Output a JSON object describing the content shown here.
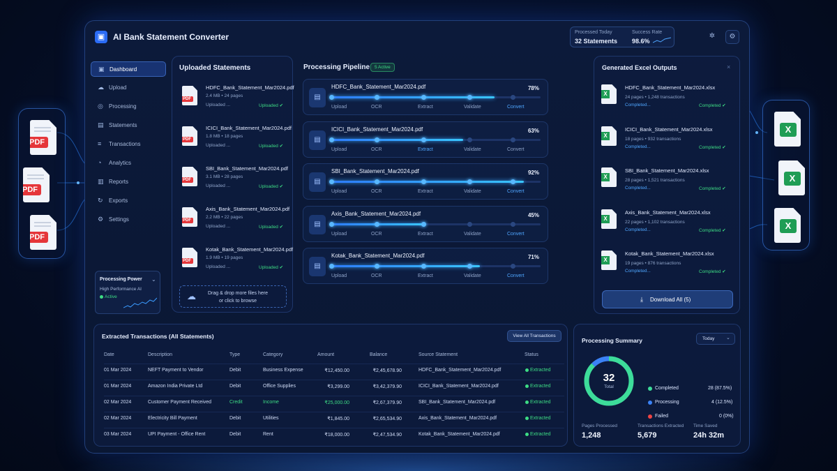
{
  "app": {
    "title": "AI Bank Statement Converter"
  },
  "header_stats": {
    "processed_label": "Processed Today",
    "processed_value": "32 Statements",
    "success_label": "Success Rate",
    "success_value": "98.6%"
  },
  "side_left": {
    "tag": "PDF"
  },
  "side_right": {
    "tag": "X"
  },
  "sidebar": {
    "items": [
      {
        "label": "Dashboard",
        "icon": "dashboard-icon"
      },
      {
        "label": "Upload",
        "icon": "upload-icon"
      },
      {
        "label": "Processing",
        "icon": "processing-icon"
      },
      {
        "label": "Statements",
        "icon": "statements-icon"
      },
      {
        "label": "Transactions",
        "icon": "transactions-icon"
      },
      {
        "label": "Analytics",
        "icon": "analytics-icon"
      },
      {
        "label": "Reports",
        "icon": "reports-icon"
      },
      {
        "label": "Exports",
        "icon": "exports-icon"
      },
      {
        "label": "Settings",
        "icon": "settings-icon"
      }
    ],
    "power": {
      "title": "Processing Power",
      "subtitle": "High Performance AI",
      "status": "Active"
    }
  },
  "uploaded": {
    "title": "Uploaded Statements",
    "files": [
      {
        "name": "HDFC_Bank_Statement_Mar2024.pdf",
        "meta": "2.4 MB • 24 pages",
        "state": "Uploaded ...",
        "status": "Uploaded ✔"
      },
      {
        "name": "ICICI_Bank_Statement_Mar2024.pdf",
        "meta": "1.8 MB • 18 pages",
        "state": "Uploaded ...",
        "status": "Uploaded ✔"
      },
      {
        "name": "SBI_Bank_Statement_Mar2024.pdf",
        "meta": "3.1 MB • 28 pages",
        "state": "Uploaded ...",
        "status": "Uploaded ✔"
      },
      {
        "name": "Axis_Bank_Statement_Mar2024.pdf",
        "meta": "2.2 MB • 22 pages",
        "state": "Uploaded ...",
        "status": "Uploaded ✔"
      },
      {
        "name": "Kotak_Bank_Statement_Mar2024.pdf",
        "meta": "1.9 MB • 19 pages",
        "state": "Uploaded ...",
        "status": "Uploaded ✔"
      }
    ],
    "pdf_tag": "PDF",
    "drop_line1": "Drag & drop more files here",
    "drop_line2": "or click to browse"
  },
  "pipeline": {
    "title": "Processing Pipeline",
    "badge": "5 Active",
    "stages": [
      "Upload",
      "OCR",
      "Extract",
      "Validate",
      "Convert"
    ],
    "rows": [
      {
        "name": "HDFC_Bank_Statement_Mar2024.pdf",
        "percent_label": "78%",
        "progress": 0.78,
        "active_stage": 4
      },
      {
        "name": "ICICI_Bank_Statement_Mar2024.pdf",
        "percent_label": "63%",
        "progress": 0.63,
        "active_stage": 2
      },
      {
        "name": "SBI_Bank_Statement_Mar2024.pdf",
        "percent_label": "92%",
        "progress": 0.92,
        "active_stage": 4
      },
      {
        "name": "Axis_Bank_Statement_Mar2024.pdf",
        "percent_label": "45%",
        "progress": 0.45,
        "active_stage": 4
      },
      {
        "name": "Kotak_Bank_Statement_Mar2024.pdf",
        "percent_label": "71%",
        "progress": 0.71,
        "active_stage": 4
      }
    ]
  },
  "outputs": {
    "title": "Generated Excel Outputs",
    "xl_tag": "X",
    "files": [
      {
        "name": "HDFC_Bank_Statement_Mar2024.xlsx",
        "meta": "24 pages • 1,248 transactions",
        "state": "Completed...",
        "status": "Completed ✔"
      },
      {
        "name": "ICICI_Bank_Statement_Mar2024.xlsx",
        "meta": "18 pages • 932 transactions",
        "state": "Completed...",
        "status": "Completed ✔"
      },
      {
        "name": "SBI_Bank_Statement_Mar2024.xlsx",
        "meta": "28 pages • 1,521 transactions",
        "state": "Completed...",
        "status": "Completed ✔"
      },
      {
        "name": "Axis_Bank_Statement_Mar2024.xlsx",
        "meta": "22 pages • 1,102 transactions",
        "state": "Completed...",
        "status": "Completed ✔"
      },
      {
        "name": "Kotak_Bank_Statement_Mar2024.xlsx",
        "meta": "19 pages • 876 transactions",
        "state": "Completed...",
        "status": "Completed ✔"
      }
    ],
    "download_label": "Download All (5)"
  },
  "transactions": {
    "title": "Extracted Transactions (All Statements)",
    "view_all": "View All Transactions",
    "columns": [
      "Date",
      "Description",
      "Type",
      "Category",
      "Amount",
      "Balance",
      "Source Statement",
      "Status"
    ],
    "rows": [
      [
        "01 Mar 2024",
        "NEFT Payment to Vendor",
        "Debit",
        "Business Expense",
        "₹12,450.00",
        "₹2,45,678.90",
        "HDFC_Bank_Statement_Mar2024.pdf",
        "Extracted"
      ],
      [
        "01 Mar 2024",
        "Amazon India Private Ltd",
        "Debit",
        "Office Supplies",
        "₹3,299.00",
        "₹3,42,379.90",
        "ICICI_Bank_Statement_Mar2024.pdf",
        "Extracted"
      ],
      [
        "02 Mar 2024",
        "Customer Payment Received",
        "Credit",
        "Income",
        "₹25,000.00",
        "₹2,67,379.90",
        "SBI_Bank_Statement_Mar2024.pdf",
        "Extracted"
      ],
      [
        "02 Mar 2024",
        "Electricity Bill Payment",
        "Debit",
        "Utilities",
        "₹1,845.00",
        "₹2,65,534.90",
        "Axis_Bank_Statement_Mar2024.pdf",
        "Extracted"
      ],
      [
        "03 Mar 2024",
        "UPI Payment - Office Rent",
        "Debit",
        "Rent",
        "₹18,000.00",
        "₹2,47,534.90",
        "Kotak_Bank_Statement_Mar2024.pdf",
        "Extracted"
      ]
    ]
  },
  "summary": {
    "title": "Processing Summary",
    "period": "Today",
    "total_value": "32",
    "total_label": "Total",
    "legend": [
      {
        "label": "Completed",
        "value": "28 (87.5%)",
        "color": "#3ddc9a",
        "fraction": 0.875
      },
      {
        "label": "Processing",
        "value": "4 (12.5%)",
        "color": "#3b82f6",
        "fraction": 0.125
      },
      {
        "label": "Failed",
        "value": "0 (0%)",
        "color": "#ef4444",
        "fraction": 0
      }
    ],
    "pages_label": "Pages Processed",
    "pages_value": "1,248",
    "tx_label": "Transactions Extracted",
    "tx_value": "5,679",
    "time_label": "Time Saved",
    "time_value": "24h 32m"
  }
}
